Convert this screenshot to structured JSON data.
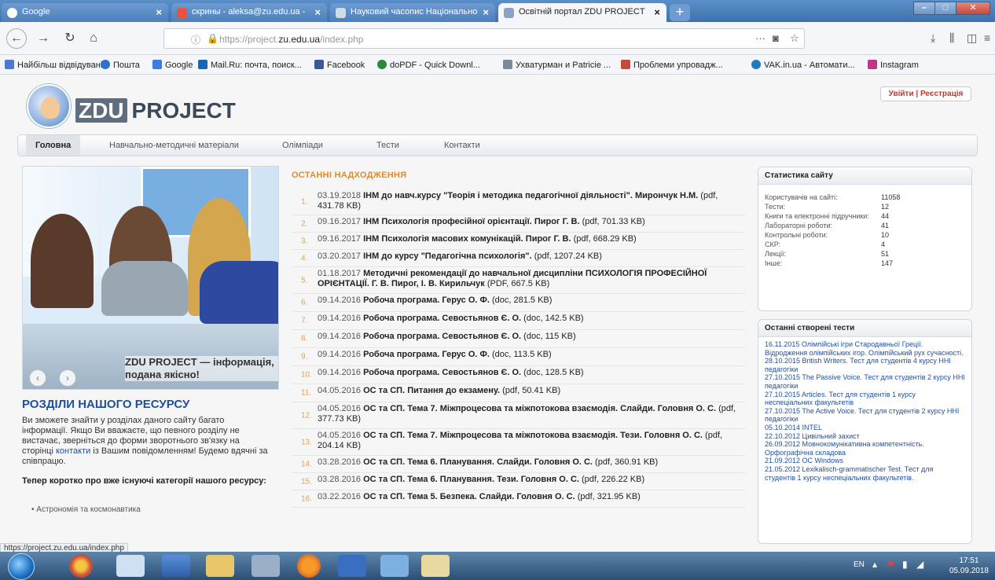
{
  "browser": {
    "tabs": [
      {
        "title": "Google",
        "active": false
      },
      {
        "title": "скрины - aleksa@zu.edu.ua - ",
        "active": false
      },
      {
        "title": "Науковий часопис Національно",
        "active": false
      },
      {
        "title": "Освітній портал ZDU PROJECT",
        "active": true
      }
    ],
    "url_host": "https://project.",
    "url_domain": "zu.edu.ua",
    "url_path": "/index.php",
    "bookmarks": [
      {
        "label": "Найбільш відвідувані",
        "color": "#4a7bd0"
      },
      {
        "label": "Пошта",
        "color": "#2b72c8"
      },
      {
        "label": "Google",
        "color": "#3a7de0"
      },
      {
        "label": "Mail.Ru: почта, поиск...",
        "color": "#1a63b5"
      },
      {
        "label": "Facebook",
        "color": "#3b5998"
      },
      {
        "label": "doPDF - Quick Downl...",
        "color": "#2a8a3a"
      },
      {
        "label": "Ухватурман и Patricie ...",
        "color": "#7a8a99"
      },
      {
        "label": "Проблеми упровадж...",
        "color": "#c84a3a"
      },
      {
        "label": "VAK.in.ua - Автомати...",
        "color": "#1f7bc0"
      },
      {
        "label": "Instagram",
        "color": "#c13584"
      }
    ]
  },
  "site": {
    "logo_box": "ZDU",
    "logo_text": "PROJECT",
    "login": "Увійти | Реєстрація",
    "nav": [
      "Головна",
      "Навчально-методичні матеріали",
      "Олімпіади",
      "Тести",
      "Контакти"
    ],
    "slider_caption": "ZDU PROJECT — інформація, подана якісно!",
    "sections_title": "РОЗДІЛИ НАШОГО РЕСУРСУ",
    "sections_text_1": "Ви зможете знайти у розділах даного сайту багато інформації. Якщо Ви вважаєте, що певного розділу не вистачає, зверніться до форми зворотнього зв'язку на сторінці ",
    "sections_link": "контакти",
    "sections_text_2": " із Вашим повідомленням! Будемо вдячні за співпрацю.",
    "categories_title": "Тепер коротко про вже існуючі категорії нашого ресурсу:",
    "categories_first": "Астрономія та космонавтика",
    "status_url": "https://project.zu.edu.ua/index.php"
  },
  "news": {
    "title": "ОСТАННІ НАДХОДЖЕННЯ",
    "items": [
      {
        "num": "1.",
        "date": "03.19.2018",
        "bold": "ІНМ до навч.курсу \"Теорія і методика педагогічної діяльності\". Мирончук Н.М.",
        "rest": " (pdf, 431.78 KB)"
      },
      {
        "num": "2.",
        "date": "09.16.2017",
        "bold": "ІНМ Психологія професійної орієнтації. Пирог Г. В.",
        "rest": " (pdf, 701.33 KB)"
      },
      {
        "num": "3.",
        "date": "09.16.2017",
        "bold": "ІНМ Психологія масових комунікацій. Пирог Г. В.",
        "rest": " (pdf, 668.29 KB)"
      },
      {
        "num": "4.",
        "date": "03.20.2017",
        "bold": "ІНМ до курсу \"Педагогічна психологія\".",
        "rest": " (pdf, 1207.24 KB)"
      },
      {
        "num": "5.",
        "date": "01.18.2017",
        "bold": "Методичні рекомендації до навчальної дисципліни ПСИХОЛОГІЯ ПРОФЕСІЙНОЇ ОРІЄНТАЦІЇ. Г. В. Пирог, І. В. Кирильчук",
        "rest": " (PDF, 667.5 KB)"
      },
      {
        "num": "6.",
        "date": "09.14.2016",
        "bold": "Робоча програма. Герус О. Ф.",
        "rest": " (doc, 281.5 KB)"
      },
      {
        "num": "7.",
        "date": "09.14.2016",
        "bold": "Робоча програма. Севостьянов Є. О.",
        "rest": " (doc, 142.5 KB)"
      },
      {
        "num": "8.",
        "date": "09.14.2016",
        "bold": "Робоча програма. Севостьянов Є. О.",
        "rest": " (doc, 115 KB)"
      },
      {
        "num": "9.",
        "date": "09.14.2016",
        "bold": "Робоча програма. Герус О. Ф.",
        "rest": " (doc, 113.5 KB)"
      },
      {
        "num": "10.",
        "date": "09.14.2016",
        "bold": "Робоча програма. Севостьянов Є. О.",
        "rest": " (doc, 128.5 KB)"
      },
      {
        "num": "11.",
        "date": "04.05.2016",
        "bold": "ОС та СП. Питання до екзамену.",
        "rest": " (pdf, 50.41 KB)"
      },
      {
        "num": "12.",
        "date": "04.05.2016",
        "bold": "ОС та СП. Тема 7. Міжпроцесова та міжпотокова взаємодія. Слайди. Головня О. С.",
        "rest": " (pdf, 377.73 KB)"
      },
      {
        "num": "13.",
        "date": "04.05.2016",
        "bold": "ОС та СП. Тема 7. Міжпроцесова та міжпотокова взаємодія. Тези. Головня О. С.",
        "rest": " (pdf, 204.14 KB)"
      },
      {
        "num": "14.",
        "date": "03.28.2016",
        "bold": "ОС та СП. Тема 6. Планування. Слайди. Головня О. С.",
        "rest": " (pdf, 360.91 KB)"
      },
      {
        "num": "15.",
        "date": "03.28.2016",
        "bold": "ОС та СП. Тема 6. Планування. Тези. Головня О. С.",
        "rest": " (pdf, 226.22 KB)"
      },
      {
        "num": "16.",
        "date": "03.22.2016",
        "bold": "ОС та СП. Тема 5. Безпека. Слайди. Головня О. С.",
        "rest": " (pdf, 321.95 KB)"
      }
    ]
  },
  "stats": {
    "title": "Статистика сайту",
    "rows": [
      {
        "label": "Користувачів на сайті:",
        "value": "11058"
      },
      {
        "label": "Тести:",
        "value": "12"
      },
      {
        "label": "Книги та електронні підручники:",
        "value": "44"
      },
      {
        "label": "Лабораторні роботи:",
        "value": "41"
      },
      {
        "label": "Контрольні роботи:",
        "value": "10"
      },
      {
        "label": "СКР:",
        "value": "4"
      },
      {
        "label": "Лекції:",
        "value": "51"
      },
      {
        "label": "Інше:",
        "value": "147"
      }
    ]
  },
  "tests": {
    "title": "Останні створені тести",
    "items": [
      "16.11.2015 Олімпійські ігри Стародавньої Греції. Відродження олімпійських ігор. Олімпійський рух сучасності.",
      "28.10.2015 British Writers. Тест для студентів 4 курсу ННІ педагогіки",
      "27.10.2015 The Passive Voice. Тест для студентів 2 курсу ННІ педагогіки",
      "27.10.2015 Articles. Тест для студентів 1 курсу неспеціальних факультетів",
      "27.10.2015 The Active Voice. Тест для студентів 2 курсу ННІ педагогіки",
      "05.10.2014 INTEL",
      "22.10.2012 Цивільний захист",
      "26.09.2012 Мовнокомунікативна компетентність. Орфографічна складова",
      "21.09.2012 ОС Windows",
      "21.05.2012 Lexikalisch-grammatischer Test. Тест для студентів 1 курсу неспеціальних факультетів."
    ]
  },
  "taskbar": {
    "lang": "EN",
    "time": "17:51",
    "date": "05.09.2018"
  }
}
